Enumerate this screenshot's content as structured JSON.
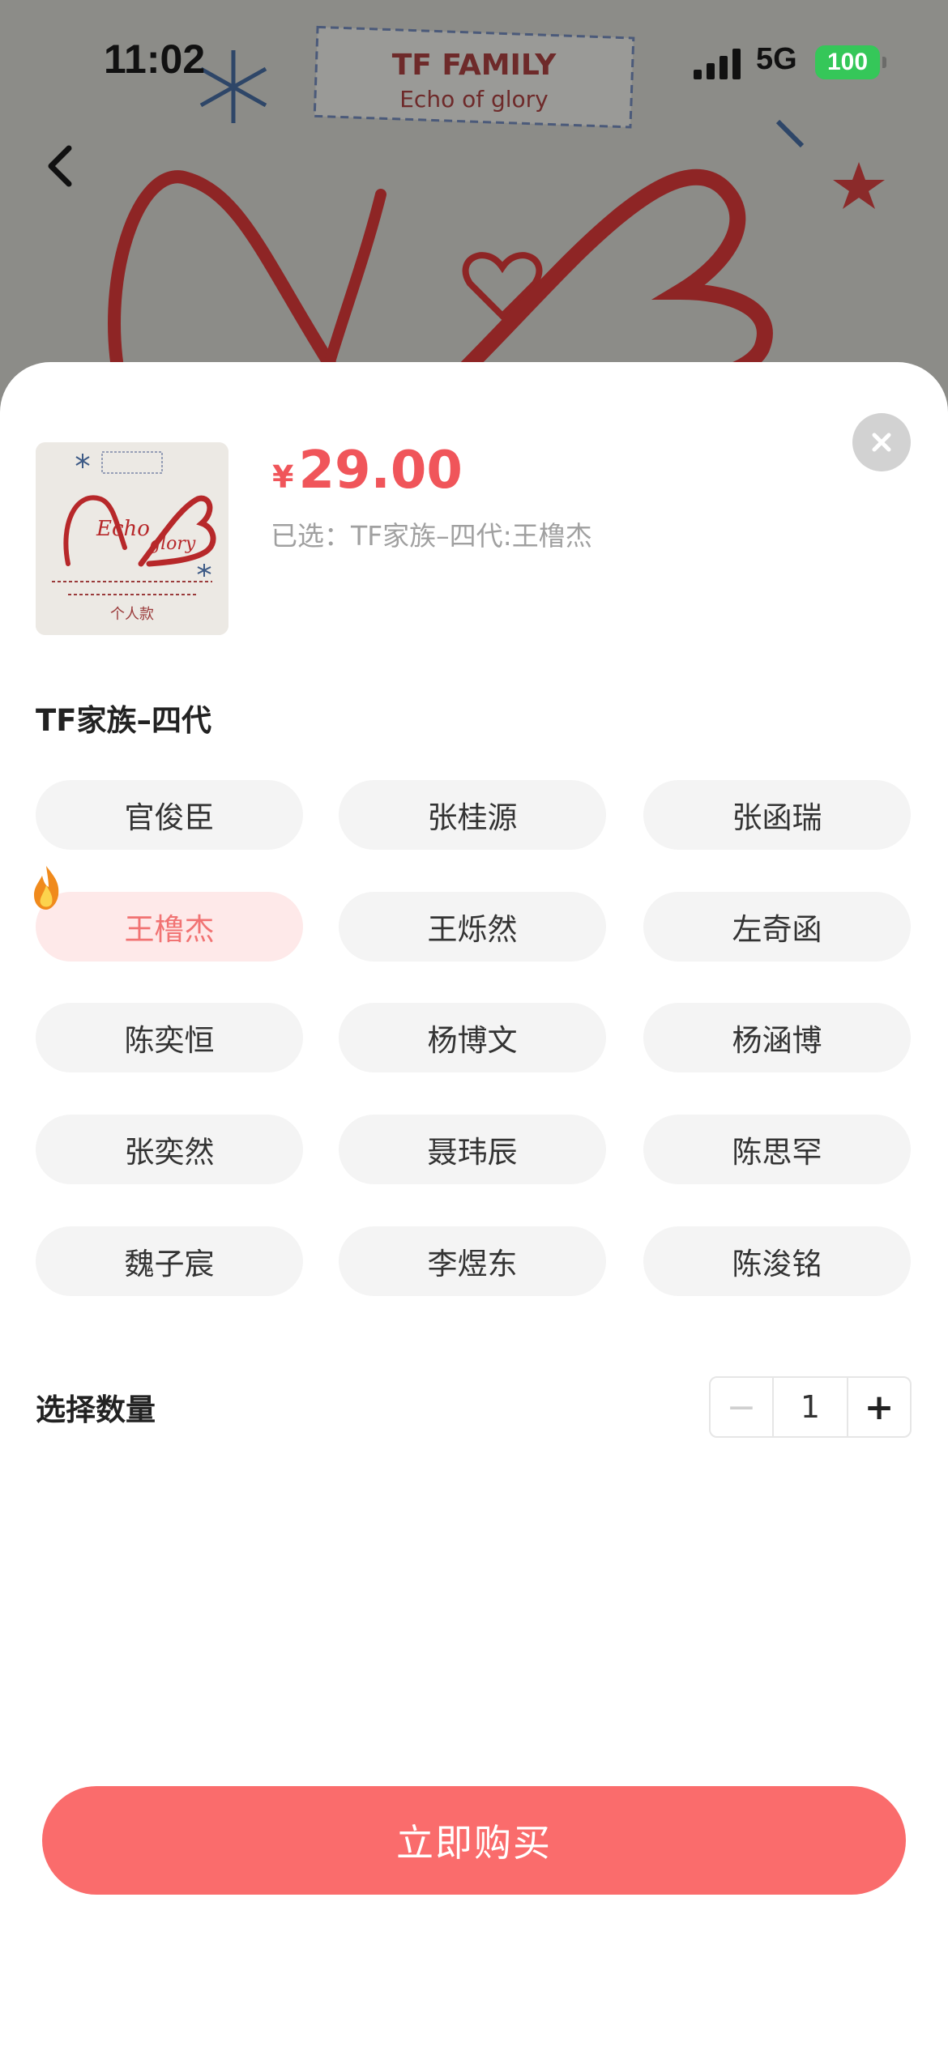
{
  "status_bar": {
    "time": "11:02",
    "network": "5G",
    "battery": "100"
  },
  "hero": {
    "label_line1": "TF FAMILY",
    "label_line2": "Echo of glory"
  },
  "product": {
    "thumb_text_1": "Echo",
    "thumb_text_2": "glory",
    "thumb_caption": "个人款",
    "price_symbol": "¥",
    "price": "29.00",
    "selected_info": "已选：TF家族–四代:王橹杰"
  },
  "options": {
    "group_title": "TF家族–四代",
    "items": [
      "官俊臣",
      "张桂源",
      "张函瑞",
      "王橹杰",
      "王烁然",
      "左奇函",
      "陈奕恒",
      "杨博文",
      "杨涵博",
      "张奕然",
      "聂玮辰",
      "陈思罕",
      "魏子宸",
      "李煜东",
      "陈浚铭"
    ],
    "selected": "王橹杰"
  },
  "quantity": {
    "label": "选择数量",
    "minus": "−",
    "value": "1",
    "plus": "+"
  },
  "actions": {
    "buy_label": "立即购买"
  },
  "colors": {
    "accent": "#fa6c6c",
    "price": "#f0555a",
    "selected_chip_bg": "#fee9e9",
    "battery": "#35c759"
  },
  "icons": {
    "back": "chevron-left-icon",
    "close": "close-icon",
    "hot": "flame-icon",
    "signal": "signal-icon"
  }
}
